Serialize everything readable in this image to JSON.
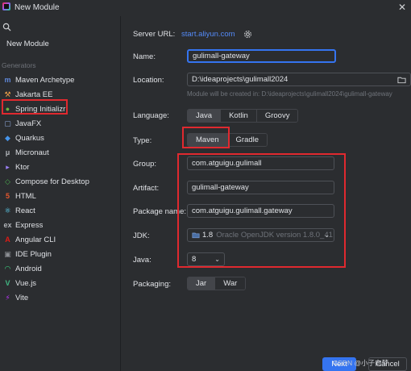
{
  "window": {
    "title": "New Module"
  },
  "sidebar": {
    "new_module": "New Module",
    "generators_label": "Generators",
    "items": [
      {
        "label": "Maven Archetype",
        "icon": "maven-icon",
        "glyph": "m",
        "color": "#5f87d8"
      },
      {
        "label": "Jakarta EE",
        "icon": "jakarta-icon",
        "glyph": "⚒",
        "color": "#f1a24b"
      },
      {
        "label": "Spring Initializr",
        "icon": "spring-icon",
        "glyph": "●",
        "color": "#6db33f"
      },
      {
        "label": "JavaFX",
        "icon": "javafx-icon",
        "glyph": "▢",
        "color": "#8aa4d6"
      },
      {
        "label": "Quarkus",
        "icon": "quarkus-icon",
        "glyph": "◆",
        "color": "#4695eb"
      },
      {
        "label": "Micronaut",
        "icon": "micronaut-icon",
        "glyph": "μ",
        "color": "#b0b3b8"
      },
      {
        "label": "Ktor",
        "icon": "ktor-icon",
        "glyph": "▸",
        "color": "#9b7ff4"
      },
      {
        "label": "Compose for Desktop",
        "icon": "compose-icon",
        "glyph": "◇",
        "color": "#4caf50"
      },
      {
        "label": "HTML",
        "icon": "html-icon",
        "glyph": "5",
        "color": "#e4572e"
      },
      {
        "label": "React",
        "icon": "react-icon",
        "glyph": "⚛",
        "color": "#61dafb"
      },
      {
        "label": "Express",
        "icon": "express-icon",
        "glyph": "ex",
        "color": "#b0b3b8"
      },
      {
        "label": "Angular CLI",
        "icon": "angular-icon",
        "glyph": "A",
        "color": "#dd1b16"
      },
      {
        "label": "IDE Plugin",
        "icon": "ide-plugin-icon",
        "glyph": "▣",
        "color": "#8c8f94"
      },
      {
        "label": "Android",
        "icon": "android-icon",
        "glyph": "◠",
        "color": "#3ddc84"
      },
      {
        "label": "Vue.js",
        "icon": "vue-icon",
        "glyph": "V",
        "color": "#41b883"
      },
      {
        "label": "Vite",
        "icon": "vite-icon",
        "glyph": "⚡",
        "color": "#bd34fe"
      }
    ],
    "help": "?"
  },
  "form": {
    "server_url_label": "Server URL:",
    "server_url": "start.aliyun.com",
    "name_label": "Name:",
    "name": "gulimall-gateway",
    "location_label": "Location:",
    "location": "D:\\ideaprojects\\gulimall2024",
    "location_hint": "Module will be created in: D:\\ideaprojects\\gulimall2024\\gulimall-gateway",
    "language_label": "Language:",
    "languages": [
      "Java",
      "Kotlin",
      "Groovy"
    ],
    "type_label": "Type:",
    "types": [
      "Maven",
      "Gradle"
    ],
    "group_label": "Group:",
    "group": "com.atguigu.gulimall",
    "artifact_label": "Artifact:",
    "artifact": "gulimall-gateway",
    "package_label": "Package name:",
    "package": "com.atguigu.gulimall.gateway",
    "jdk_label": "JDK:",
    "jdk_version": "1.8",
    "jdk_detail": "Oracle OpenJDK version 1.8.0_41",
    "java_label": "Java:",
    "java": "8",
    "packaging_label": "Packaging:",
    "packagings": [
      "Jar",
      "War"
    ]
  },
  "footer": {
    "next": "Next",
    "cancel": "Cancel",
    "watermark": "CSDN @小子向梦"
  },
  "colors": {
    "accent": "#3574f0",
    "highlight_box": "#e0292f",
    "selected_row": "#2e436e"
  }
}
